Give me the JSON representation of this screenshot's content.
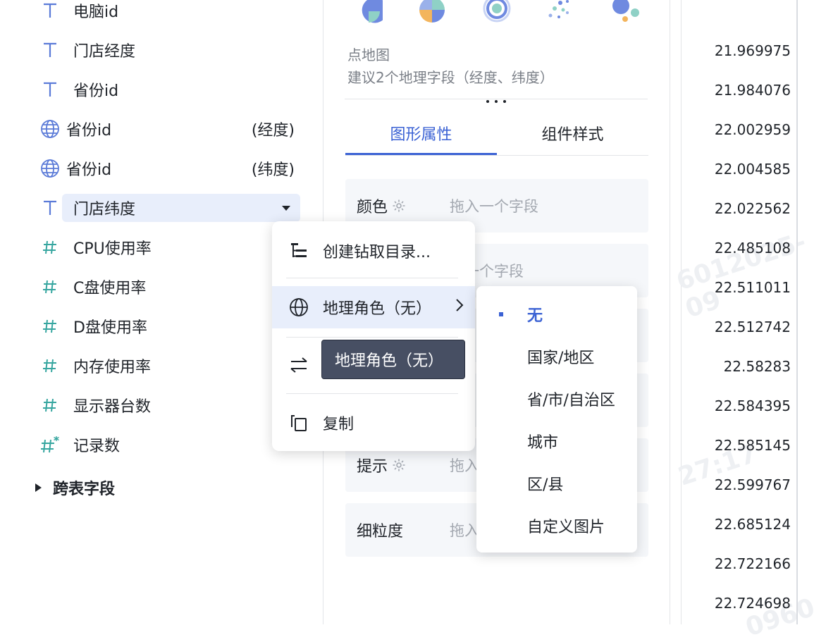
{
  "fields": [
    {
      "type": "text",
      "name": "电脑id",
      "suffix": ""
    },
    {
      "type": "text",
      "name": "门店经度",
      "suffix": ""
    },
    {
      "type": "text",
      "name": "省份id",
      "suffix": ""
    },
    {
      "type": "geo",
      "name": "省份id",
      "suffix": "(经度)"
    },
    {
      "type": "geo",
      "name": "省份id",
      "suffix": "(纬度)"
    },
    {
      "type": "text",
      "name": "门店纬度",
      "suffix": "",
      "selected": true
    },
    {
      "type": "number",
      "name": "CPU使用率",
      "suffix": ""
    },
    {
      "type": "number",
      "name": "C盘使用率",
      "suffix": ""
    },
    {
      "type": "number",
      "name": "D盘使用率",
      "suffix": ""
    },
    {
      "type": "number",
      "name": "内存使用率",
      "suffix": ""
    },
    {
      "type": "number",
      "name": "显示器台数",
      "suffix": ""
    },
    {
      "type": "number-calc",
      "name": "记录数",
      "suffix": ""
    }
  ],
  "cross_table_label": "跨表字段",
  "middle": {
    "map_title": "点地图",
    "map_hint": "建议2个地理字段（经度、纬度）",
    "more": "⋮⋮⋮",
    "tabs": [
      {
        "label": "图形属性",
        "active": true
      },
      {
        "label": "组件样式",
        "active": false
      }
    ],
    "props": [
      {
        "label": "颜色",
        "gear": true,
        "placeholder": "拖入一个字段"
      },
      {
        "label": "",
        "gear": false,
        "placeholder": "入一个字段"
      },
      {
        "label": "",
        "gear": false,
        "placeholder": ""
      },
      {
        "label": "",
        "gear": false,
        "placeholder": ""
      },
      {
        "label": "提示",
        "gear": true,
        "placeholder": "拖入"
      },
      {
        "label": "细粒度",
        "gear": false,
        "placeholder": "拖入"
      }
    ]
  },
  "values": [
    "21.969975",
    "21.984076",
    "22.002959",
    "22.004585",
    "22.022562",
    "22.485108",
    "22.511011",
    "22.512742",
    "22.58283",
    "22.584395",
    "22.585145",
    "22.599767",
    "22.685124",
    "22.722166",
    "22.724698"
  ],
  "watermarks": [
    "6012025-09",
    "27:17",
    "0960"
  ],
  "context_menu": {
    "items": [
      {
        "label": "创建钻取目录...",
        "icon": "tree-icon"
      },
      {
        "label": "地理角色（无）",
        "icon": "globe-icon",
        "submenu": true
      },
      {
        "label": "",
        "icon": "swap-icon"
      },
      {
        "label": "复制",
        "icon": "copy-icon"
      }
    ],
    "tooltip": "地理角色（无）"
  },
  "sub_menu": {
    "items": [
      {
        "label": "无",
        "active": true
      },
      {
        "label": "国家/地区",
        "active": false
      },
      {
        "label": "省/市/自治区",
        "active": false
      },
      {
        "label": "城市",
        "active": false
      },
      {
        "label": "区/县",
        "active": false
      },
      {
        "label": "自定义图片",
        "active": false
      }
    ]
  },
  "colors": {
    "accent": "#3b62d4",
    "text_icon": "#5b7bd8",
    "number_icon": "#37a6a0",
    "tooltip_bg": "#474f63",
    "hover_bg": "#e8eefb"
  }
}
